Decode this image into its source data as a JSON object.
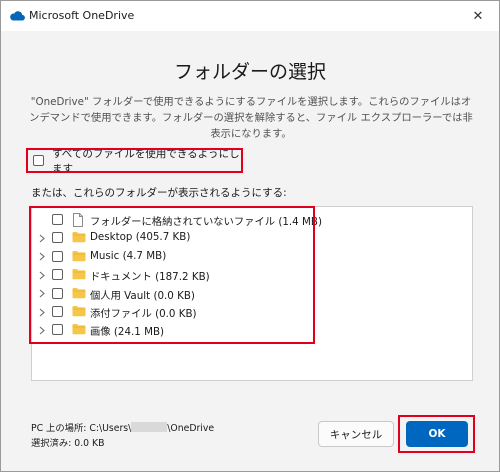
{
  "window": {
    "title": "Microsoft OneDrive",
    "close_glyph": "✕"
  },
  "heading": "フォルダーの選択",
  "description": "\"OneDrive\" フォルダーで使用できるようにするファイルを選択します。これらのファイルはオンデマンドで使用できます。フォルダーの選択を解除すると、ファイル エクスプローラーでは非表示になります。",
  "all_files_label": "すべてのファイルを使用できるようにします",
  "or_label": "または、これらのフォルダーが表示されるようにする:",
  "tree": [
    {
      "name": "フォルダーに格納されていないファイル",
      "size": "(1.4 MB)",
      "icon": "file-icon",
      "expandable": false
    },
    {
      "name": "Desktop",
      "size": "(405.7 KB)",
      "icon": "folder-icon",
      "expandable": true
    },
    {
      "name": "Music",
      "size": "(4.7 MB)",
      "icon": "folder-icon",
      "expandable": true
    },
    {
      "name": "ドキュメント",
      "size": "(187.2 KB)",
      "icon": "folder-icon",
      "expandable": true
    },
    {
      "name": "個人用 Vault",
      "size": "(0.0 KB)",
      "icon": "folder-icon",
      "expandable": true
    },
    {
      "name": "添付ファイル",
      "size": "(0.0 KB)",
      "icon": "folder-icon",
      "expandable": true
    },
    {
      "name": "画像",
      "size": "(24.1 MB)",
      "icon": "folder-icon",
      "expandable": true
    }
  ],
  "footer": {
    "location_prefix": "PC 上の場所: C:\\Users\\",
    "location_suffix": "\\OneDrive",
    "selected": "選択済み: 0.0 KB"
  },
  "buttons": {
    "cancel": "キャンセル",
    "ok": "OK"
  },
  "colors": {
    "accent": "#0067c0",
    "highlight": "#e0001b",
    "folder": "#f5c648"
  }
}
